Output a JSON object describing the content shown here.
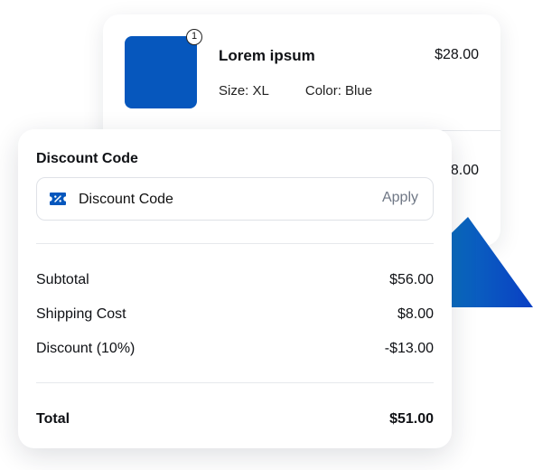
{
  "product": {
    "name": "Lorem ipsum",
    "price": "$28.00",
    "size": "Size: XL",
    "color": "Color: Blue",
    "quantity_badge": "1"
  },
  "second_item": {
    "price_fragment": "8.00"
  },
  "discount": {
    "title": "Discount Code",
    "input_placeholder": "Discount Code",
    "input_icon": "discount-ticket-icon",
    "apply_label": "Apply"
  },
  "summary": {
    "rows": [
      {
        "label": "Subtotal",
        "value": "$56.00"
      },
      {
        "label": "Shipping Cost",
        "value": "$8.00"
      },
      {
        "label": "Discount (10%)",
        "value": "-$13.00"
      }
    ],
    "total": {
      "label": "Total",
      "value": "$51.00"
    }
  },
  "colors": {
    "brand_blue": "#0657bd",
    "gradient_start": "#0a93b8",
    "gradient_end": "#0a3fc4",
    "muted_text": "#6f7785"
  }
}
